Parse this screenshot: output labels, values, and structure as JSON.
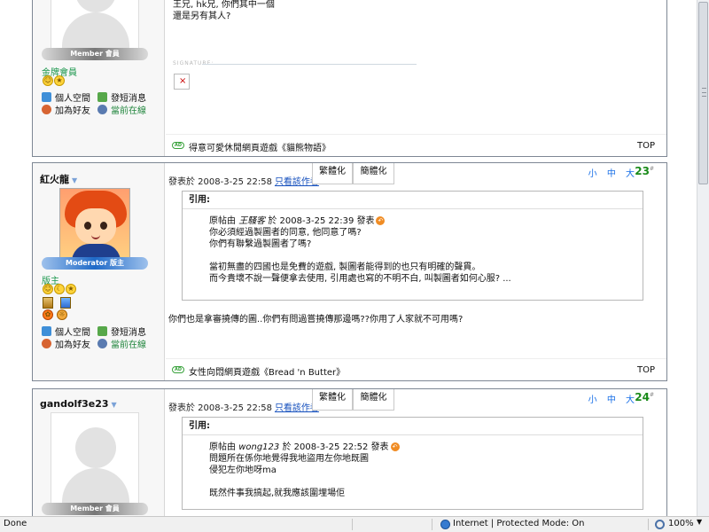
{
  "posts": [
    {
      "text_lines": [
        "王兄, hk兄, 你們其中一個",
        "還是另有其人?"
      ],
      "member_rank": "Member 會員",
      "member_title": "金牌會員",
      "actions": {
        "home": "個人空間",
        "message": "發短消息",
        "add_friend": "加為好友",
        "online": "當前在線"
      },
      "signature_label": "SIGNATURE:",
      "ad": "得意可愛休閒網頁遊戲《貓熊物語》",
      "top": "TOP"
    },
    {
      "username": "紅火龍",
      "rank": "Moderator 版主",
      "title": "版主",
      "date": "發表於 2008-3-25 22:58",
      "author_only": "只看該作者",
      "tab_traditional": "繁體化",
      "tab_simplified": "簡體化",
      "font_sizes": "小 中 大",
      "number": "23",
      "number_suffix": "#",
      "quote_label": "引用:",
      "quote_intro": "原帖由",
      "quote_author": "王騷客",
      "quote_date": "於 2008-3-25 22:39 發表",
      "quote_lines": [
        "你必須經過製圖者的同意, 他同意了嗎?",
        "你們有聯繫過製圖者了嗎?",
        "",
        "當初無盡的四國也是免費的遊戲, 製圖者能得到的也只有明確的聲貫。",
        "而今貴壞不說一聲便拿去使用, 引用處也寫的不明不白, 叫製圖者如何心服? ..."
      ],
      "reply": "你們也是拿審撓傳的圖..你們有問過嘗撓傳那邊嗎??你用了人家就不可用嗎?",
      "ad": "女性向悶網頁遊戲《Bread 'n Butter》",
      "top": "TOP"
    },
    {
      "username": "gandolf3e23",
      "rank": "Member 會員",
      "date": "發表於 2008-3-25 22:58",
      "author_only": "只看該作者",
      "tab_traditional": "繁體化",
      "tab_simplified": "簡體化",
      "font_sizes": "小 中 大",
      "number": "24",
      "number_suffix": "#",
      "quote_label": "引用:",
      "quote_intro": "原帖由",
      "quote_author": "wong123",
      "quote_date": "於 2008-3-25 22:52 發表",
      "quote_lines": [
        "問題所在係你地覺得我地盜用左你地既圖",
        "侵犯左你地呀ma",
        "",
        "既然件事我搞起,就我應該圍埋場佢"
      ]
    }
  ],
  "statusbar": {
    "left": "Done",
    "zone": "Internet | Protected Mode: On",
    "zoom": "100%"
  },
  "colors": {
    "accent_blue": "#166ee7",
    "green": "#1a8b1a",
    "moderator_blue": "#1f6ac8"
  }
}
